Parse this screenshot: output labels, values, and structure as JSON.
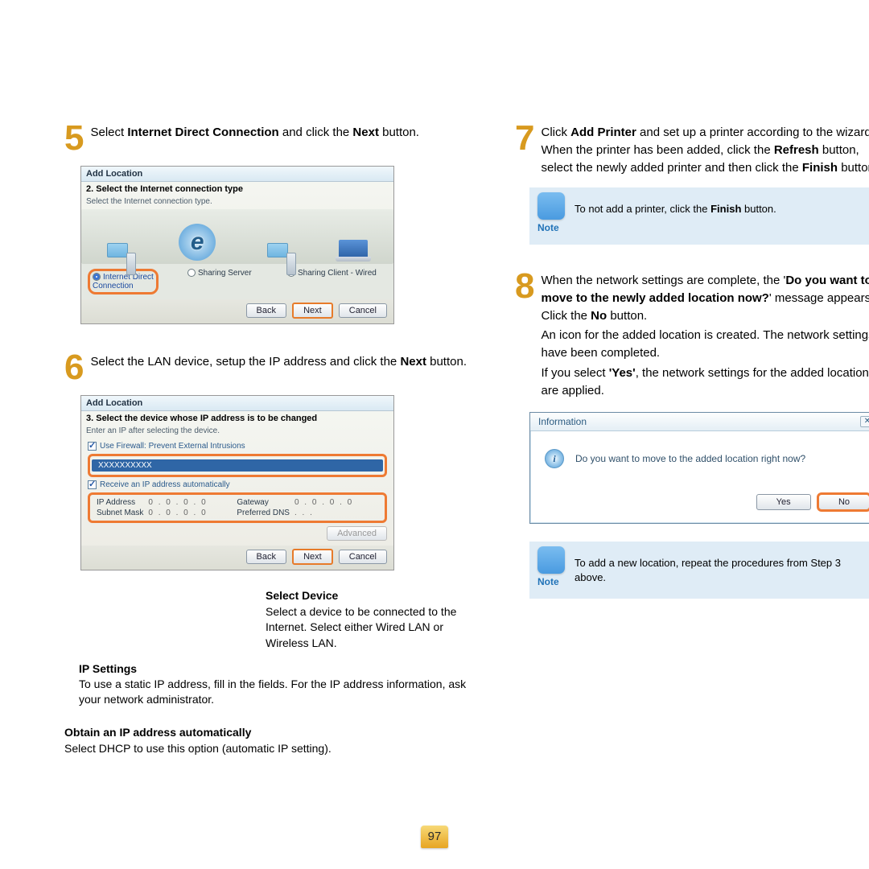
{
  "page_number": "97",
  "left": {
    "step5": {
      "num": "5",
      "text_pre": "Select ",
      "bold1": "Internet Direct Connection",
      "text_mid": " and click the ",
      "bold2": "Next",
      "text_post": " button."
    },
    "win5": {
      "title": "Add Location",
      "sub": "2. Select the Internet connection type",
      "hint": "Select the Internet connection type.",
      "ie_letter": "e",
      "opt_sel": "Internet Direct\nConnection",
      "opt2": "Sharing Server",
      "opt3": "Sharing Client - Wired",
      "back": "Back",
      "next": "Next",
      "cancel": "Cancel"
    },
    "step6": {
      "num": "6",
      "text": "Select the LAN device, setup the IP address and click the ",
      "bold": "Next",
      "text_post": " button."
    },
    "win6": {
      "title": "Add Location",
      "sub": "3. Select the device whose IP address is to be changed",
      "hint": "Enter an IP after selecting the device.",
      "chk1": "Use Firewall: Prevent External Intrusions",
      "device": "XXXXXXXXXX",
      "chk2": "Receive an IP address automatically",
      "lbl_ip": "IP Address",
      "lbl_sub": "Subnet Mask",
      "lbl_gw": "Gateway",
      "lbl_dns": "Preferred DNS",
      "val_zero": "0  .  0  .  0  .  0",
      "val_dots": ".     .     .",
      "advanced": "Advanced",
      "back": "Back",
      "next": "Next",
      "cancel": "Cancel"
    },
    "callouts": {
      "select_device_h": "Select Device",
      "select_device_p": "Select a device to be connected to the Internet. Select either Wired LAN or Wireless LAN.",
      "ip_h": "IP Settings",
      "ip_p": "To use a static IP address, fill in the fields. For the IP address information, ask your network administrator.",
      "auto_h": "Obtain an IP address automatically",
      "auto_p": "Select DHCP to use this option (automatic IP setting)."
    }
  },
  "right": {
    "step7": {
      "num": "7",
      "t1": "Click ",
      "b1": "Add Printer",
      "t2": " and set up a printer according to the wizard. When the printer has been added, click the ",
      "b2": "Refresh",
      "t3": " button, select the newly added printer and then click the ",
      "b3": "Finish",
      "t4": " button."
    },
    "note1": {
      "label": "Note",
      "t1": "To not add a printer, click the ",
      "b": "Finish",
      "t2": " button."
    },
    "step8": {
      "num": "8",
      "t1": "When the network settings are complete, the '",
      "b1": "Do you want to move to the newly added location now?",
      "t2": "' message appears. Click the ",
      "b2": "No",
      "t3": " button.",
      "p2": "An icon for the added location is created. The network settings have been completed.",
      "t4": "If you select ",
      "b3": "'Yes'",
      "t5": ", the network settings for the added location are applied."
    },
    "dlg": {
      "title": "Information",
      "x": "✕",
      "i": "i",
      "msg": "Do you want to move to the added location right now?",
      "yes": "Yes",
      "no": "No"
    },
    "note2": {
      "label": "Note",
      "text": "To add a new location, repeat the procedures from Step 3 above."
    }
  }
}
